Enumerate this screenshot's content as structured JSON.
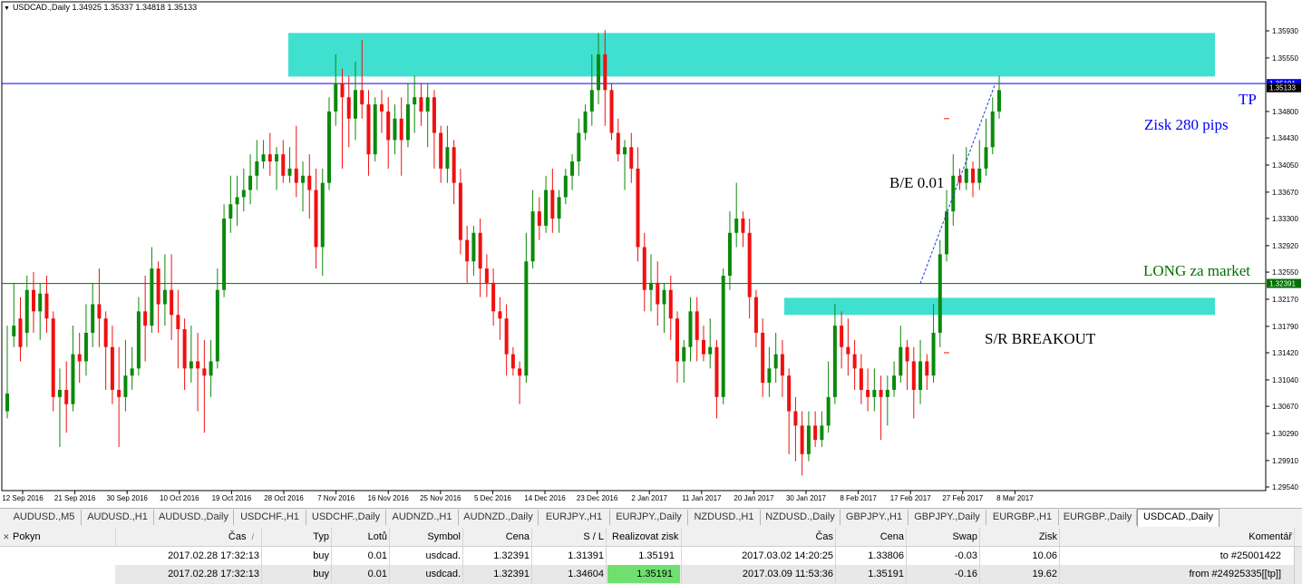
{
  "chart": {
    "header_arrow": "▼",
    "header_text": "USDCAD.,Daily  1.34925 1.35337 1.34818 1.35133",
    "colors": {
      "bull": "#0a8a0a",
      "bear": "#f01010",
      "zone": "#40e0d0",
      "tp_line": "#0000ff",
      "entry_line": "#007000",
      "trend": "#1e3fd6"
    },
    "price_min": 1.2936,
    "price_max": 1.3594,
    "price_labels": [
      "1.35930",
      "1.35550",
      "1.35191",
      "1.35133",
      "1.34800",
      "1.34430",
      "1.34050",
      "1.33670",
      "1.33300",
      "1.32920",
      "1.32550",
      "1.32391",
      "1.32170",
      "1.31790",
      "1.31420",
      "1.31040",
      "1.30670",
      "1.30290",
      "1.29910",
      "1.29540"
    ],
    "tp_price": 1.35191,
    "entry_price": 1.32391,
    "current_price": "1.35133",
    "zone_high": [
      1.359,
      1.3529
    ],
    "zone_low": [
      1.3219,
      1.3195
    ],
    "date_labels": [
      "12 Sep 2016",
      "21 Sep 2016",
      "30 Sep 2016",
      "10 Oct 2016",
      "19 Oct 2016",
      "28 Oct 2016",
      "7 Nov 2016",
      "16 Nov 2016",
      "25 Nov 2016",
      "5 Dec 2016",
      "14 Dec 2016",
      "23 Dec 2016",
      "2 Jan 2017",
      "11 Jan 2017",
      "20 Jan 2017",
      "30 Jan 2017",
      "8 Feb 2017",
      "17 Feb 2017",
      "27 Feb 2017",
      "8 Mar 2017"
    ],
    "candles": [
      [
        1.306,
        1.3085,
        1.318,
        1.305
      ],
      [
        1.3165,
        1.318,
        1.324,
        1.315
      ],
      [
        1.319,
        1.315,
        1.322,
        1.313
      ],
      [
        1.317,
        1.323,
        1.325,
        1.315
      ],
      [
        1.323,
        1.32,
        1.3255,
        1.317
      ],
      [
        1.32,
        1.3225,
        1.324,
        1.316
      ],
      [
        1.3225,
        1.319,
        1.325,
        1.317
      ],
      [
        1.319,
        1.308,
        1.32,
        1.306
      ],
      [
        1.308,
        1.309,
        1.312,
        1.301
      ],
      [
        1.309,
        1.307,
        1.313,
        1.303
      ],
      [
        1.307,
        1.314,
        1.318,
        1.306
      ],
      [
        1.314,
        1.313,
        1.317,
        1.31
      ],
      [
        1.313,
        1.317,
        1.321,
        1.311
      ],
      [
        1.317,
        1.321,
        1.324,
        1.315
      ],
      [
        1.321,
        1.319,
        1.326,
        1.315
      ],
      [
        1.319,
        1.315,
        1.32,
        1.309
      ],
      [
        1.315,
        1.309,
        1.318,
        1.307
      ],
      [
        1.309,
        1.308,
        1.315,
        1.301
      ],
      [
        1.308,
        1.311,
        1.316,
        1.306
      ],
      [
        1.311,
        1.312,
        1.315,
        1.309
      ],
      [
        1.312,
        1.32,
        1.322,
        1.311
      ],
      [
        1.32,
        1.318,
        1.325,
        1.313
      ],
      [
        1.318,
        1.326,
        1.329,
        1.317
      ],
      [
        1.326,
        1.321,
        1.327,
        1.317
      ],
      [
        1.321,
        1.323,
        1.328,
        1.318
      ],
      [
        1.323,
        1.3195,
        1.328,
        1.316
      ],
      [
        1.3195,
        1.3175,
        1.323,
        1.312
      ],
      [
        1.3175,
        1.312,
        1.319,
        1.309
      ],
      [
        1.312,
        1.313,
        1.318,
        1.31
      ],
      [
        1.313,
        1.312,
        1.317,
        1.306
      ],
      [
        1.312,
        1.311,
        1.316,
        1.303
      ],
      [
        1.311,
        1.313,
        1.316,
        1.308
      ],
      [
        1.313,
        1.323,
        1.326,
        1.312
      ],
      [
        1.323,
        1.333,
        1.335,
        1.322
      ],
      [
        1.333,
        1.335,
        1.339,
        1.331
      ],
      [
        1.335,
        1.336,
        1.339,
        1.332
      ],
      [
        1.336,
        1.337,
        1.34,
        1.334
      ],
      [
        1.337,
        1.339,
        1.342,
        1.335
      ],
      [
        1.339,
        1.341,
        1.344,
        1.337
      ],
      [
        1.341,
        1.342,
        1.344,
        1.34
      ],
      [
        1.342,
        1.341,
        1.345,
        1.339
      ],
      [
        1.341,
        1.342,
        1.343,
        1.337
      ],
      [
        1.342,
        1.339,
        1.344,
        1.338
      ],
      [
        1.339,
        1.34,
        1.343,
        1.338
      ],
      [
        1.34,
        1.338,
        1.346,
        1.336
      ],
      [
        1.338,
        1.339,
        1.341,
        1.334
      ],
      [
        1.339,
        1.337,
        1.342,
        1.333
      ],
      [
        1.337,
        1.329,
        1.34,
        1.326
      ],
      [
        1.329,
        1.338,
        1.34,
        1.325
      ],
      [
        1.338,
        1.348,
        1.35,
        1.337
      ],
      [
        1.348,
        1.352,
        1.356,
        1.346
      ],
      [
        1.352,
        1.35,
        1.354,
        1.34
      ],
      [
        1.35,
        1.347,
        1.353,
        1.343
      ],
      [
        1.347,
        1.351,
        1.355,
        1.344
      ],
      [
        1.351,
        1.349,
        1.358,
        1.347
      ],
      [
        1.349,
        1.342,
        1.351,
        1.339
      ],
      [
        1.342,
        1.349,
        1.35,
        1.341
      ],
      [
        1.349,
        1.348,
        1.351,
        1.345
      ],
      [
        1.348,
        1.344,
        1.35,
        1.34
      ],
      [
        1.344,
        1.347,
        1.349,
        1.342
      ],
      [
        1.347,
        1.344,
        1.35,
        1.339
      ],
      [
        1.344,
        1.349,
        1.352,
        1.343
      ],
      [
        1.349,
        1.35,
        1.353,
        1.345
      ],
      [
        1.35,
        1.348,
        1.352,
        1.346
      ],
      [
        1.348,
        1.35,
        1.352,
        1.343
      ],
      [
        1.35,
        1.345,
        1.351,
        1.34
      ],
      [
        1.345,
        1.34,
        1.346,
        1.338
      ],
      [
        1.34,
        1.343,
        1.346,
        1.338
      ],
      [
        1.343,
        1.338,
        1.344,
        1.335
      ],
      [
        1.338,
        1.33,
        1.34,
        1.328
      ],
      [
        1.33,
        1.327,
        1.332,
        1.324
      ],
      [
        1.327,
        1.331,
        1.332,
        1.325
      ],
      [
        1.331,
        1.326,
        1.333,
        1.322
      ],
      [
        1.326,
        1.324,
        1.328,
        1.322
      ],
      [
        1.324,
        1.32,
        1.326,
        1.318
      ],
      [
        1.32,
        1.319,
        1.322,
        1.316
      ],
      [
        1.319,
        1.314,
        1.321,
        1.311
      ],
      [
        1.314,
        1.312,
        1.315,
        1.311
      ],
      [
        1.312,
        1.311,
        1.313,
        1.307
      ],
      [
        1.311,
        1.327,
        1.331,
        1.31
      ],
      [
        1.327,
        1.334,
        1.337,
        1.326
      ],
      [
        1.334,
        1.332,
        1.336,
        1.33
      ],
      [
        1.332,
        1.337,
        1.339,
        1.331
      ],
      [
        1.337,
        1.333,
        1.34,
        1.331
      ],
      [
        1.333,
        1.336,
        1.337,
        1.331
      ],
      [
        1.336,
        1.339,
        1.34,
        1.335
      ],
      [
        1.339,
        1.341,
        1.342,
        1.337
      ],
      [
        1.341,
        1.345,
        1.347,
        1.339
      ],
      [
        1.345,
        1.348,
        1.349,
        1.344
      ],
      [
        1.348,
        1.351,
        1.356,
        1.346
      ],
      [
        1.351,
        1.356,
        1.359,
        1.349
      ],
      [
        1.356,
        1.351,
        1.3594,
        1.346
      ],
      [
        1.351,
        1.345,
        1.352,
        1.344
      ],
      [
        1.345,
        1.342,
        1.347,
        1.341
      ],
      [
        1.342,
        1.343,
        1.344,
        1.337
      ],
      [
        1.343,
        1.34,
        1.345,
        1.338
      ],
      [
        1.34,
        1.329,
        1.343,
        1.327
      ],
      [
        1.329,
        1.323,
        1.331,
        1.32
      ],
      [
        1.323,
        1.324,
        1.328,
        1.32
      ],
      [
        1.324,
        1.321,
        1.327,
        1.318
      ],
      [
        1.321,
        1.323,
        1.324,
        1.317
      ],
      [
        1.323,
        1.319,
        1.325,
        1.316
      ],
      [
        1.319,
        1.313,
        1.32,
        1.31
      ],
      [
        1.313,
        1.315,
        1.316,
        1.31
      ],
      [
        1.315,
        1.32,
        1.322,
        1.313
      ],
      [
        1.32,
        1.316,
        1.322,
        1.313
      ],
      [
        1.316,
        1.314,
        1.318,
        1.313
      ],
      [
        1.314,
        1.315,
        1.319,
        1.312
      ],
      [
        1.315,
        1.308,
        1.316,
        1.305
      ],
      [
        1.308,
        1.325,
        1.326,
        1.307
      ],
      [
        1.325,
        1.331,
        1.334,
        1.323
      ],
      [
        1.331,
        1.333,
        1.338,
        1.329
      ],
      [
        1.333,
        1.331,
        1.334,
        1.329
      ],
      [
        1.331,
        1.322,
        1.333,
        1.319
      ],
      [
        1.322,
        1.317,
        1.323,
        1.315
      ],
      [
        1.317,
        1.31,
        1.319,
        1.308
      ],
      [
        1.31,
        1.312,
        1.315,
        1.308
      ],
      [
        1.312,
        1.314,
        1.317,
        1.31
      ],
      [
        1.314,
        1.311,
        1.316,
        1.308
      ],
      [
        1.311,
        1.306,
        1.312,
        1.3
      ],
      [
        1.306,
        1.304,
        1.308,
        1.299
      ],
      [
        1.304,
        1.3,
        1.306,
        1.297
      ],
      [
        1.3,
        1.304,
        1.306,
        1.299
      ],
      [
        1.304,
        1.302,
        1.306,
        1.301
      ],
      [
        1.302,
        1.304,
        1.306,
        1.301
      ],
      [
        1.304,
        1.308,
        1.313,
        1.303
      ],
      [
        1.308,
        1.318,
        1.321,
        1.307
      ],
      [
        1.318,
        1.315,
        1.32,
        1.312
      ],
      [
        1.315,
        1.314,
        1.319,
        1.311
      ],
      [
        1.314,
        1.312,
        1.316,
        1.309
      ],
      [
        1.312,
        1.309,
        1.314,
        1.307
      ],
      [
        1.309,
        1.308,
        1.312,
        1.306
      ],
      [
        1.308,
        1.309,
        1.312,
        1.306
      ],
      [
        1.309,
        1.308,
        1.311,
        1.302
      ],
      [
        1.308,
        1.309,
        1.311,
        1.304
      ],
      [
        1.309,
        1.311,
        1.313,
        1.308
      ],
      [
        1.311,
        1.315,
        1.318,
        1.31
      ],
      [
        1.315,
        1.313,
        1.316,
        1.309
      ],
      [
        1.313,
        1.309,
        1.315,
        1.305
      ],
      [
        1.309,
        1.313,
        1.316,
        1.307
      ],
      [
        1.313,
        1.311,
        1.314,
        1.309
      ],
      [
        1.311,
        1.317,
        1.321,
        1.31
      ],
      [
        1.317,
        1.328,
        1.33,
        1.315
      ],
      [
        1.328,
        1.334,
        1.337,
        1.327
      ],
      [
        1.334,
        1.339,
        1.342,
        1.332
      ],
      [
        1.339,
        1.338,
        1.34,
        1.337
      ],
      [
        1.338,
        1.34,
        1.343,
        1.337
      ],
      [
        1.34,
        1.338,
        1.341,
        1.336
      ],
      [
        1.338,
        1.34,
        1.344,
        1.337
      ],
      [
        1.34,
        1.343,
        1.347,
        1.339
      ],
      [
        1.343,
        1.348,
        1.35,
        1.342
      ],
      [
        1.348,
        1.351,
        1.353,
        1.347
      ]
    ],
    "annotations": {
      "tp": "TP",
      "zisk": "Zisk 280 pips",
      "be": "B/E 0.01",
      "long": "LONG za market",
      "sr": "S/R BREAKOUT"
    }
  },
  "tabs": [
    "AUDUSD.,M5",
    "AUDUSD.,H1",
    "AUDUSD.,Daily",
    "USDCHF.,H1",
    "USDCHF.,Daily",
    "AUDNZD.,H1",
    "AUDNZD.,Daily",
    "EURJPY.,H1",
    "EURJPY.,Daily",
    "NZDUSD.,H1",
    "NZDUSD.,Daily",
    "GBPJPY.,H1",
    "GBPJPY.,Daily",
    "EURGBP.,H1",
    "EURGBP.,Daily",
    "USDCAD.,Daily"
  ],
  "active_tab": "USDCAD.,Daily",
  "grid": {
    "headers": {
      "pokyn": "Pokyn",
      "cas1": "Čas",
      "sort": "/",
      "typ": "Typ",
      "lotu": "Lotů",
      "symbol": "Symbol",
      "cena1": "Cena",
      "sl": "S / L",
      "realizovat": "Realizovat zisk",
      "cas2": "Čas",
      "cena2": "Cena",
      "swap": "Swap",
      "zisk": "Zisk",
      "komentar": "Komentář"
    },
    "rows": [
      {
        "cas1": "2017.02.28 17:32:13",
        "typ": "buy",
        "lotu": "0.01",
        "symbol": "usdcad.",
        "cena1": "1.32391",
        "sl": "1.31391",
        "realizovat": "1.35191",
        "cas2": "2017.03.02 14:20:25",
        "cena2": "1.33806",
        "swap": "-0.03",
        "zisk": "10.06",
        "komentar": "to #25001422"
      },
      {
        "cas1": "2017.02.28 17:32:13",
        "typ": "buy",
        "lotu": "0.01",
        "symbol": "usdcad.",
        "cena1": "1.32391",
        "sl": "1.34604",
        "realizovat": "1.35191",
        "cas2": "2017.03.09 11:53:36",
        "cena2": "1.35191",
        "swap": "-0.16",
        "zisk": "19.62",
        "komentar": "from #24925335[[tp]]"
      }
    ]
  }
}
